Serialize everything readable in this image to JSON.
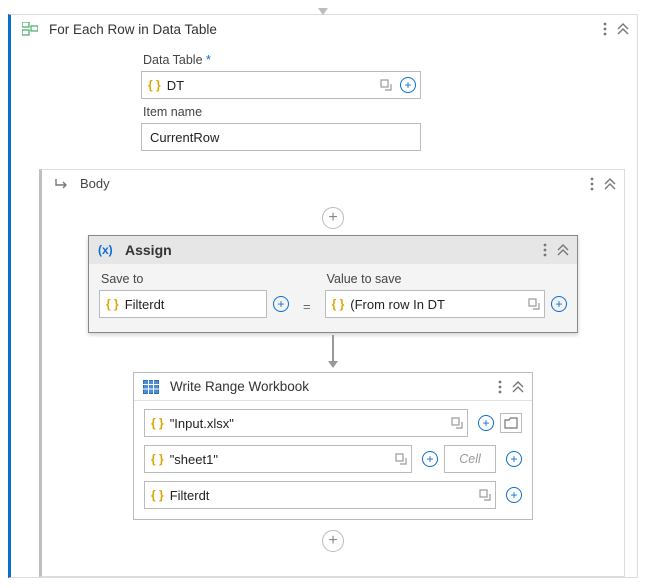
{
  "forEach": {
    "title": "For Each Row in Data Table",
    "dataTableLabel": "Data Table",
    "required": "*",
    "dataTableValue": "DT",
    "itemNameLabel": "Item name",
    "itemNameValue": "CurrentRow"
  },
  "body": {
    "title": "Body"
  },
  "assign": {
    "title": "Assign",
    "saveToLabel": "Save to",
    "saveToValue": "Filterdt",
    "valueLabel": "Value to save",
    "valueExpr": "(From row In DT",
    "equals": "="
  },
  "writeRange": {
    "title": "Write Range Workbook",
    "path": "\"Input.xlsx\"",
    "sheet": "\"sheet1\"",
    "cellPlaceholder": "Cell",
    "data": "Filterdt"
  }
}
